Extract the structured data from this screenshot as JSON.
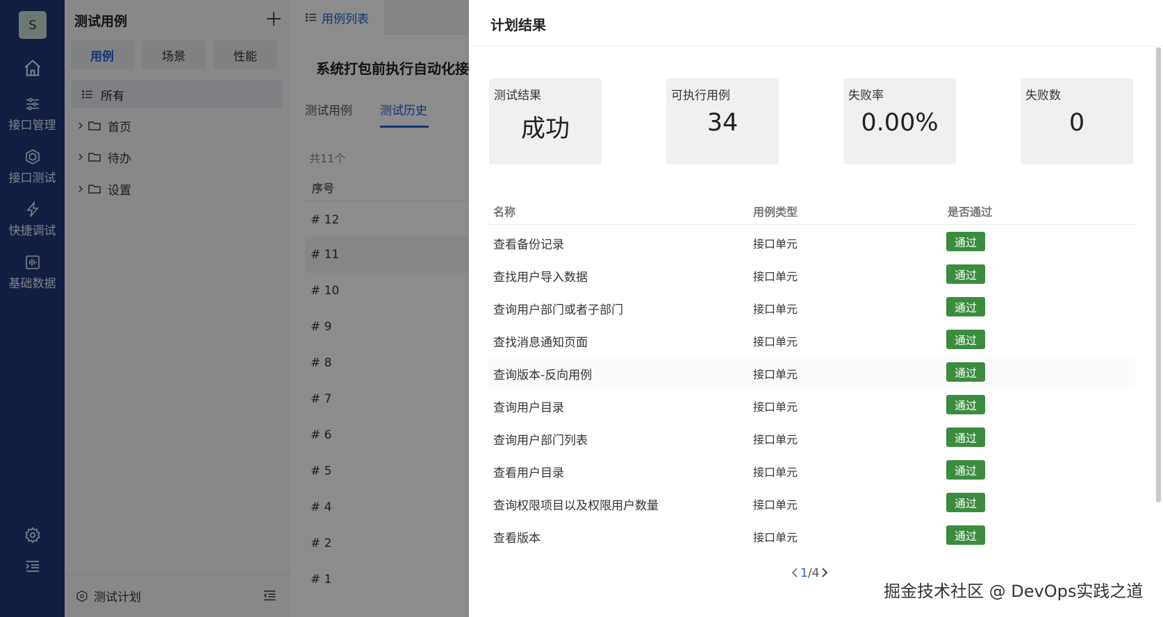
{
  "rail": {
    "avatar": "S",
    "items": [
      {
        "label": "接口管理",
        "icon": "sliders-icon"
      },
      {
        "label": "接口测试",
        "icon": "hexagon-icon"
      },
      {
        "label": "快捷调试",
        "icon": "lightning-icon"
      },
      {
        "label": "基础数据",
        "icon": "waveform-icon"
      }
    ]
  },
  "panel": {
    "title": "测试用例",
    "segments": [
      "用例",
      "场景",
      "性能"
    ],
    "tree_all": "所有",
    "folders": [
      "首页",
      "待办",
      "设置"
    ],
    "footer": "测试计划"
  },
  "main": {
    "tab": "用例列表",
    "plan_title": "系统打包前执行自动化接",
    "subtabs": [
      "测试用例",
      "测试历史"
    ],
    "total": "共11个",
    "col_index": "序号",
    "history_rows": [
      "# 12",
      "# 11",
      "# 10",
      "# 9",
      "# 8",
      "# 7",
      "# 6",
      "# 5",
      "# 4",
      "# 2",
      "# 1"
    ]
  },
  "drawer": {
    "title": "计划结果",
    "stats": [
      {
        "label": "测试结果",
        "value": "成功"
      },
      {
        "label": "可执行用例",
        "value": "34"
      },
      {
        "label": "失败率",
        "value": "0.00%"
      },
      {
        "label": "失败数",
        "value": "0"
      }
    ],
    "columns": [
      "名称",
      "用例类型",
      "是否通过"
    ],
    "rows": [
      {
        "name": "查看备份记录",
        "type": "接口单元",
        "status": "通过"
      },
      {
        "name": "查找用户导入数据",
        "type": "接口单元",
        "status": "通过"
      },
      {
        "name": "查询用户部门或者子部门",
        "type": "接口单元",
        "status": "通过"
      },
      {
        "name": "查找消息通知页面",
        "type": "接口单元",
        "status": "通过"
      },
      {
        "name": "查询版本-反向用例",
        "type": "接口单元",
        "status": "通过"
      },
      {
        "name": "查询用户目录",
        "type": "接口单元",
        "status": "通过"
      },
      {
        "name": "查询用户部门列表",
        "type": "接口单元",
        "status": "通过"
      },
      {
        "name": "查看用户目录",
        "type": "接口单元",
        "status": "通过"
      },
      {
        "name": "查询权限项目以及权限用户数量",
        "type": "接口单元",
        "status": "通过"
      },
      {
        "name": "查看版本",
        "type": "接口单元",
        "status": "通过"
      }
    ],
    "pager": {
      "current": "1",
      "separator": "/",
      "total": " 4"
    }
  },
  "watermark": "掘金技术社区 @ DevOps实践之道",
  "colors": {
    "rail": "#213a7a",
    "accent": "#1f5fd6",
    "pass_badge": "#3b8c3e"
  }
}
